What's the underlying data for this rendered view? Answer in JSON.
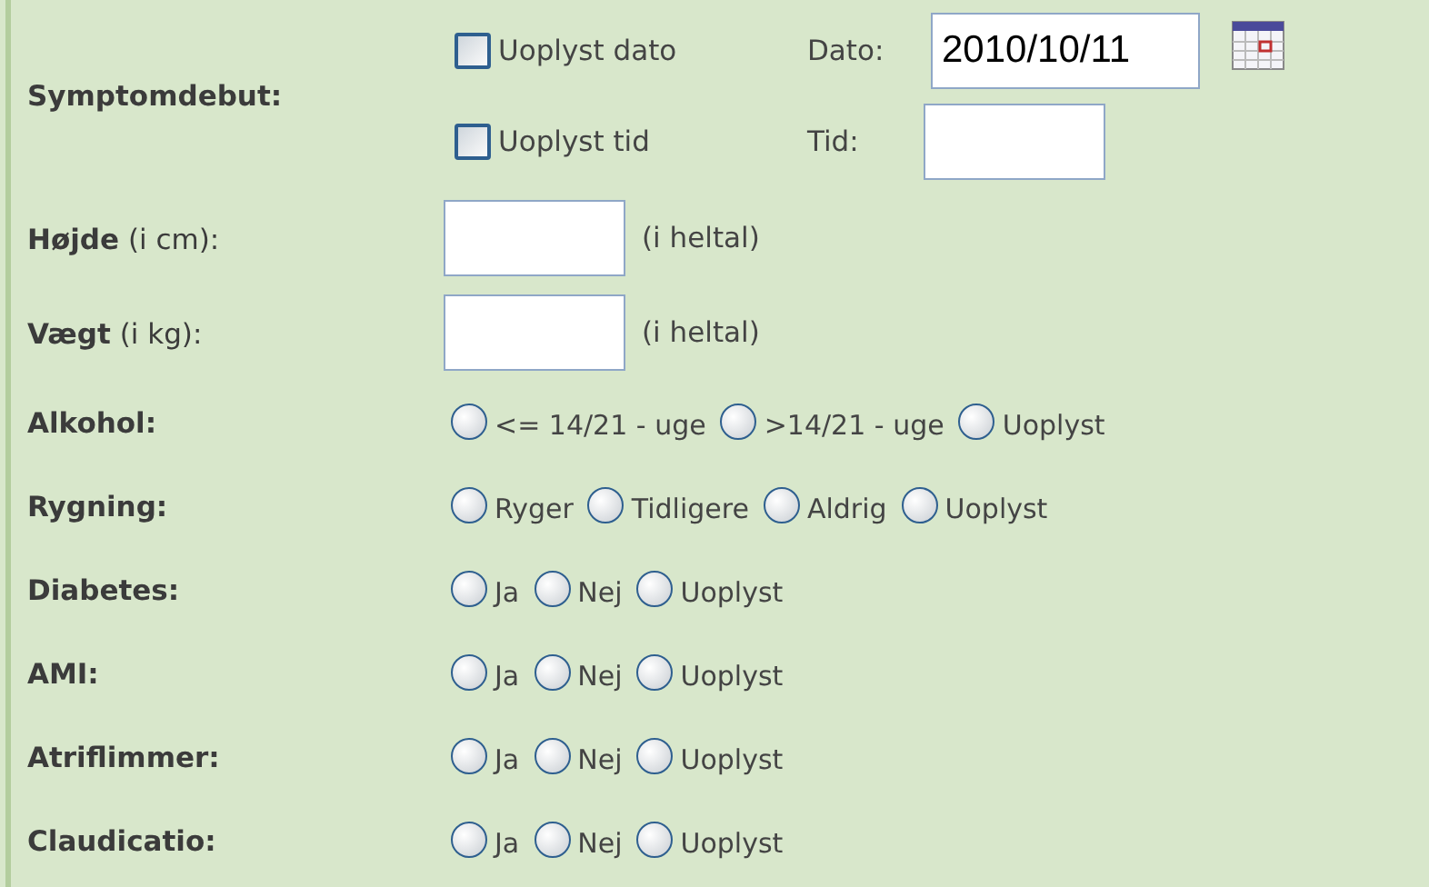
{
  "symptomdebut": {
    "label": "Symptomdebut:",
    "rows": [
      {
        "checkbox_label": "Uoplyst dato",
        "checked": false,
        "field_label": "Dato:",
        "value": "2010/10/11",
        "calendar": true
      },
      {
        "checkbox_label": "Uoplyst tid",
        "checked": false,
        "field_label": "Tid:",
        "calendar": false
      }
    ]
  },
  "measurements": [
    {
      "label": "**Højde** (i cm):",
      "hint": "(i heltal)"
    },
    {
      "label": "**Vægt** (i kg):",
      "hint": "(i heltal)"
    }
  ],
  "radio_groups": [
    {
      "label": "Alkohol:",
      "options": [
        {
          "label": "<= 14/21 - uge",
          "selected": false
        },
        {
          "label": ">14/21 - uge",
          "selected": false
        },
        {
          "label": "Uoplyst",
          "selected": false
        }
      ]
    },
    {
      "label": "Rygning:",
      "options": [
        {
          "label": "Ryger",
          "selected": false
        },
        {
          "label": "Tidligere",
          "selected": false
        },
        {
          "label": "Aldrig",
          "selected": false
        },
        {
          "label": "Uoplyst",
          "selected": false
        }
      ]
    },
    {
      "label": "Diabetes:",
      "options": [
        {
          "label": "Ja",
          "selected": false
        },
        {
          "label": "Nej",
          "selected": false
        },
        {
          "label": "Uoplyst",
          "selected": false
        }
      ]
    },
    {
      "label": "AMI:",
      "options": [
        {
          "label": "Ja",
          "selected": false
        },
        {
          "label": "Nej",
          "selected": false
        },
        {
          "label": "Uoplyst",
          "selected": false
        }
      ]
    },
    {
      "label": "Atriflimmer:",
      "options": [
        {
          "label": "Ja",
          "selected": false
        },
        {
          "label": "Nej",
          "selected": false
        },
        {
          "label": "Uoplyst",
          "selected": false
        }
      ]
    },
    {
      "label": "Claudicatio:",
      "options": [
        {
          "label": "Ja",
          "selected": false
        },
        {
          "label": "Nej",
          "selected": false
        },
        {
          "label": "Uoplyst",
          "selected": false
        }
      ]
    }
  ]
}
